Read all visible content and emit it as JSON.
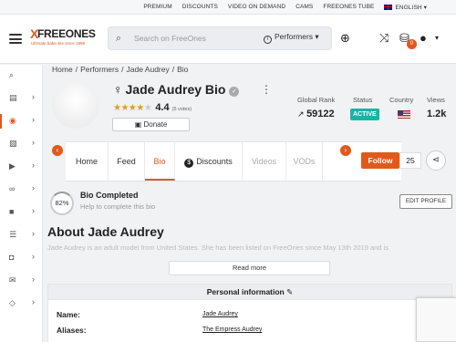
{
  "topbar": {
    "links": [
      "PREMIUM",
      "DISCOUNTS",
      "VIDEO ON DEMAND",
      "CAMS",
      "FREEONES TUBE"
    ],
    "language": "ENGLISH"
  },
  "header": {
    "logo_text": "FREEONES",
    "logo_tagline": "Ultimate babe site since 1998",
    "search_placeholder": "Search on FreeOnes",
    "search_scope": "Performers",
    "notification_count": "0"
  },
  "sidebar": {
    "items": [
      {
        "icon": "search-icon",
        "glyph": "⌕"
      },
      {
        "icon": "new-icon",
        "glyph": "▤"
      },
      {
        "icon": "performers-icon",
        "glyph": "◉"
      },
      {
        "icon": "photos-icon",
        "glyph": "▧"
      },
      {
        "icon": "videos-icon",
        "glyph": "▶"
      },
      {
        "icon": "links-icon",
        "glyph": "∞"
      },
      {
        "icon": "cams-icon",
        "glyph": "■"
      },
      {
        "icon": "feed-icon",
        "glyph": "☰"
      },
      {
        "icon": "games-icon",
        "glyph": "◘"
      },
      {
        "icon": "chat-icon",
        "glyph": "✉"
      },
      {
        "icon": "premium-icon",
        "glyph": "◇"
      }
    ]
  },
  "breadcrumb": [
    "Home",
    "Performers",
    "Jade Audrey",
    "Bio"
  ],
  "profile": {
    "title": "Jade Audrey Bio",
    "rating": "4.4",
    "votes": "(5 votes)",
    "donate_label": "Donate",
    "global_rank_label": "Global Rank",
    "global_rank": "59122",
    "status_label": "Status",
    "status": "ACTIVE",
    "country_label": "Country",
    "views_label": "Views",
    "views": "1.2k"
  },
  "tabs": [
    {
      "label": "Home"
    },
    {
      "label": "Feed"
    },
    {
      "label": "Bio"
    },
    {
      "label": "Discounts"
    },
    {
      "label": "Videos"
    },
    {
      "label": "VODs"
    }
  ],
  "follow": {
    "label": "Follow",
    "count": "25"
  },
  "bio_status": {
    "percent": "82%",
    "title": "Bio Completed",
    "help": "Help to complete this bio",
    "edit_label": "EDIT PROFILE"
  },
  "about": {
    "title": "About Jade Audrey",
    "text": "Jade Audrey is an adult model from United States. She has been listed on FreeOnes since May 13th 2019 and is",
    "read_more": "Read more"
  },
  "personal_info": {
    "heading": "Personal information",
    "rows": [
      {
        "label": "Name:",
        "value": "Jade Audrey"
      },
      {
        "label": "Aliases:",
        "value": "The Empress Audrey"
      }
    ]
  },
  "colors": {
    "accent": "#e05a1c",
    "status_active": "#1bb3a5"
  }
}
